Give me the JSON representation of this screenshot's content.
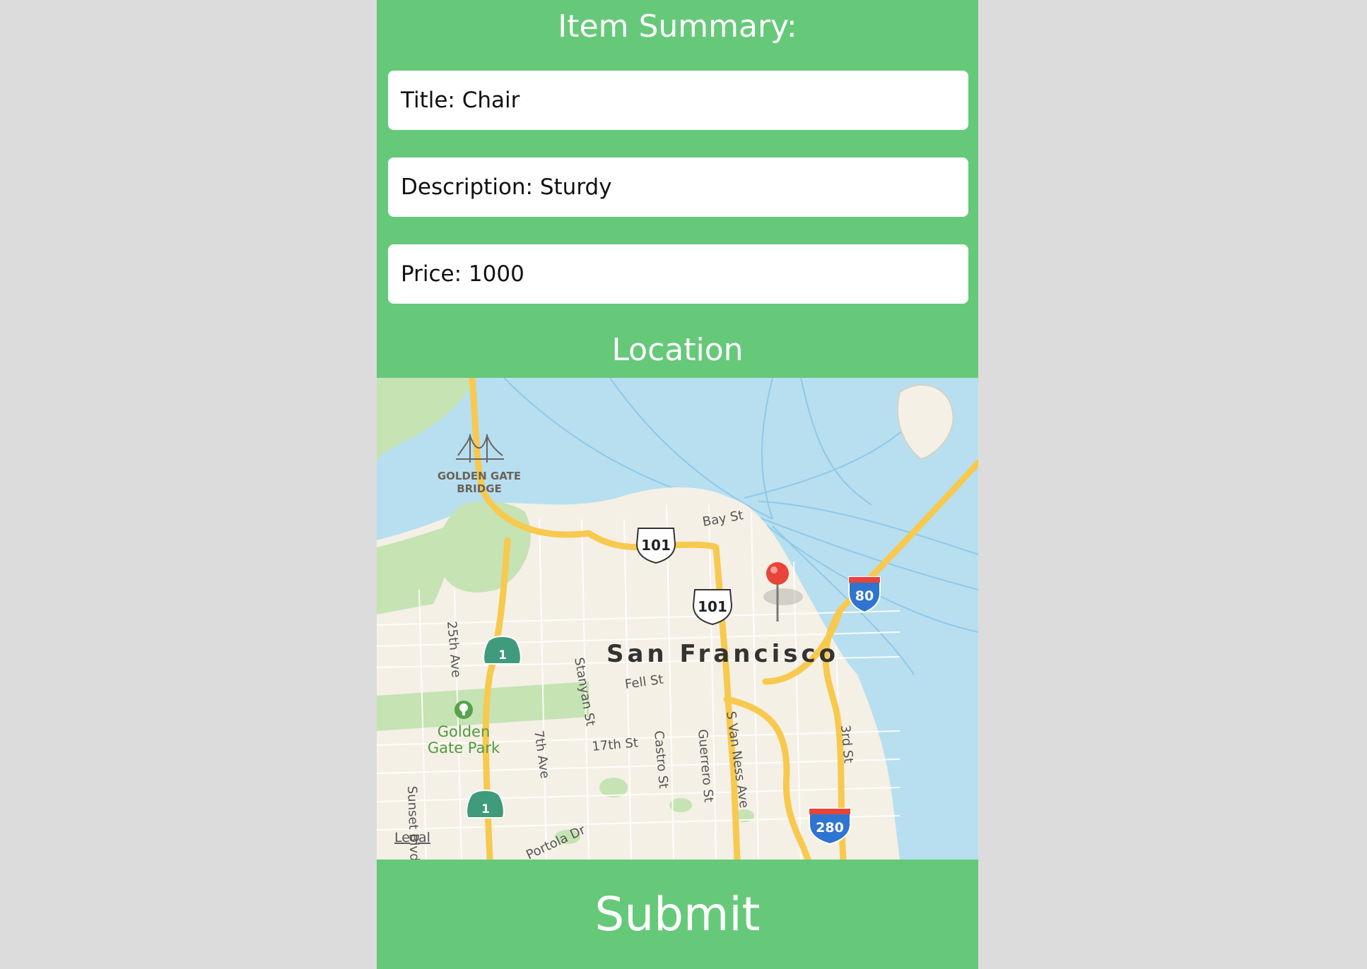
{
  "summary": {
    "heading": "Item Summary:",
    "title_text": "Title: Chair",
    "description_text": "Description: Sturdy",
    "price_text": "Price: 1000"
  },
  "location": {
    "heading": "Location"
  },
  "map": {
    "city_label": "San Francisco",
    "landmark_label_line1": "GOLDEN GATE",
    "landmark_label_line2": "BRIDGE",
    "park_label_line1": "Golden",
    "park_label_line2": "Gate Park",
    "streets": {
      "bay_st": "Bay St",
      "fell_st": "Fell St",
      "st_17th": "17th St",
      "ave_25th": "25th Ave",
      "stanyan_st": "Stanyan St",
      "ave_7th": "7th Ave",
      "castro_st": "Castro St",
      "guerrero_st": "Guerrero St",
      "s_van_ness_ave": "S Van Ness Ave",
      "st_3rd": "3rd St",
      "sunset_blvd": "Sunset Blvd",
      "portola_dr": "Portola Dr"
    },
    "shields": {
      "us101_a": "101",
      "us101_b": "101",
      "i80": "80",
      "i280": "280",
      "ca1_a": "1",
      "ca1_b": "1"
    },
    "legal_link": "Legal",
    "colors": {
      "water": "#b7dff0",
      "land": "#f4f0e6",
      "park": "#c6e3b3",
      "highway": "#f8c94f",
      "pin": "#e8443a",
      "interstate_blue": "#2f74d0",
      "state_route_green": "#3f9b7b"
    }
  },
  "submit": {
    "label": "Submit"
  },
  "theme": {
    "background": "#dcdcdc",
    "accent_green": "#66c97a"
  }
}
